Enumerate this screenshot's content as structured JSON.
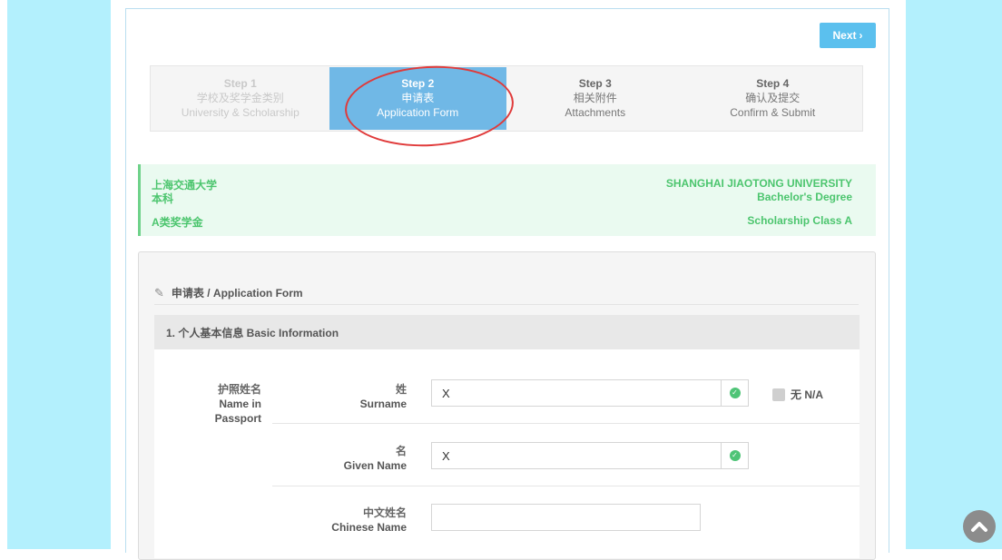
{
  "nav": {
    "next_label": "Next"
  },
  "steps": [
    {
      "title": "Step 1",
      "cn": "学校及奖学金类别",
      "en": "University & Scholarship",
      "state": "done"
    },
    {
      "title": "Step 2",
      "cn": "申请表",
      "en": "Application Form",
      "state": "active"
    },
    {
      "title": "Step 3",
      "cn": "相关附件",
      "en": "Attachments",
      "state": "todo"
    },
    {
      "title": "Step 4",
      "cn": "确认及提交",
      "en": "Confirm & Submit",
      "state": "todo"
    }
  ],
  "summary": {
    "university_cn": "上海交通大学",
    "degree_cn": "本科",
    "scholarship_cn": "A类奖学金",
    "university_en": "SHANGHAI JIAOTONG UNIVERSITY",
    "degree_en": "Bachelor's Degree",
    "scholarship_en": "Scholarship Class A"
  },
  "form": {
    "heading": "申请表 / Application Form",
    "section_title": "1. 个人基本信息 Basic Information",
    "passport_name_label": [
      "护照姓名",
      "Name in",
      "Passport"
    ],
    "surname": {
      "cn": "姓",
      "en": "Surname",
      "value": "X"
    },
    "given_name": {
      "cn": "名",
      "en": "Given Name",
      "value": "X"
    },
    "chinese_name": {
      "cn": "中文姓名",
      "en": "Chinese Name",
      "value": ""
    },
    "na_label": "无  N/A"
  },
  "icons": {
    "next": "chevron-right-icon",
    "pencil": "pencil-icon",
    "valid": "check-circle-icon",
    "scroll_top": "chevron-up-icon"
  },
  "colors": {
    "accent": "#5bc0ee",
    "active_step": "#70b8e6",
    "success": "#4cc56e",
    "side_bg": "#b3f0fd",
    "annotation": "#e03a3a"
  }
}
